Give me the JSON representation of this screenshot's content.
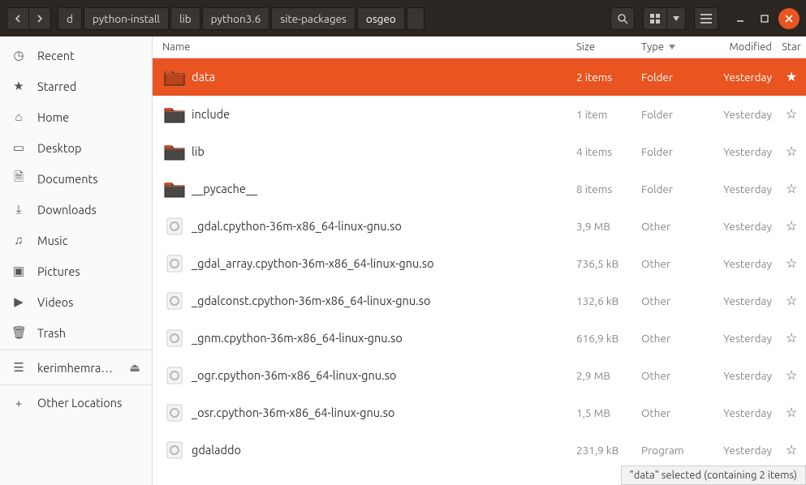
{
  "breadcrumbs": [
    "d",
    "python-install",
    "lib",
    "python3.6",
    "site-packages",
    "osgeo"
  ],
  "sidebar_top": [
    {
      "icon": "◷",
      "label": "Recent"
    },
    {
      "icon": "★",
      "label": "Starred"
    },
    {
      "icon": "⌂",
      "label": "Home"
    },
    {
      "icon": "▭",
      "label": "Desktop"
    },
    {
      "icon": "🗎",
      "label": "Documents"
    },
    {
      "icon": "⤓",
      "label": "Downloads"
    },
    {
      "icon": "♫",
      "label": "Music"
    },
    {
      "icon": "▣",
      "label": "Pictures"
    },
    {
      "icon": "▶",
      "label": "Videos"
    },
    {
      "icon": "🗑",
      "label": "Trash"
    }
  ],
  "sidebar_drive": {
    "icon": "☰",
    "label": "kerimhemra…",
    "eject": "⏏"
  },
  "sidebar_other": {
    "icon": "+",
    "label": "Other Locations"
  },
  "columns": {
    "name": "Name",
    "size": "Size",
    "type": "Type",
    "modified": "Modified",
    "star": "Star"
  },
  "files": [
    {
      "kind": "folder",
      "name": "data",
      "size": "2 items",
      "type": "Folder",
      "mod": "Yesterday",
      "selected": true,
      "starred": true
    },
    {
      "kind": "folder",
      "name": "include",
      "size": "1 item",
      "type": "Folder",
      "mod": "Yesterday"
    },
    {
      "kind": "folder",
      "name": "lib",
      "size": "4 items",
      "type": "Folder",
      "mod": "Yesterday"
    },
    {
      "kind": "folder",
      "name": "__pycache__",
      "size": "8 items",
      "type": "Folder",
      "mod": "Yesterday"
    },
    {
      "kind": "lib",
      "name": "_gdal.cpython-36m-x86_64-linux-gnu.so",
      "size": "3,9 MB",
      "type": "Other",
      "mod": "Yesterday"
    },
    {
      "kind": "lib",
      "name": "_gdal_array.cpython-36m-x86_64-linux-gnu.so",
      "size": "736,5 kB",
      "type": "Other",
      "mod": "Yesterday"
    },
    {
      "kind": "lib",
      "name": "_gdalconst.cpython-36m-x86_64-linux-gnu.so",
      "size": "132,6 kB",
      "type": "Other",
      "mod": "Yesterday"
    },
    {
      "kind": "lib",
      "name": "_gnm.cpython-36m-x86_64-linux-gnu.so",
      "size": "616,9 kB",
      "type": "Other",
      "mod": "Yesterday"
    },
    {
      "kind": "lib",
      "name": "_ogr.cpython-36m-x86_64-linux-gnu.so",
      "size": "2,9 MB",
      "type": "Other",
      "mod": "Yesterday"
    },
    {
      "kind": "lib",
      "name": "_osr.cpython-36m-x86_64-linux-gnu.so",
      "size": "1,5 MB",
      "type": "Other",
      "mod": "Yesterday"
    },
    {
      "kind": "lib",
      "name": "gdaladdo",
      "size": "231,9 kB",
      "type": "Program",
      "mod": "Yesterday"
    }
  ],
  "statusbar": "\"data\" selected  (containing 2 items)"
}
